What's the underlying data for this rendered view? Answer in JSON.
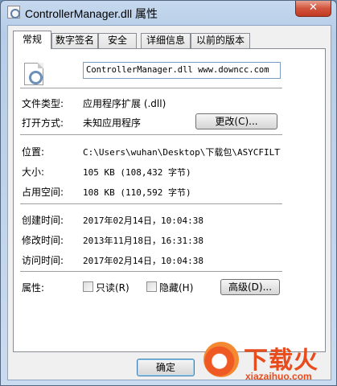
{
  "window": {
    "title": "ControllerManager.dll 属性",
    "close_glyph": "✕"
  },
  "tabs": [
    {
      "label": "常规",
      "active": true
    },
    {
      "label": "数字签名",
      "active": false
    },
    {
      "label": "安全",
      "active": false
    },
    {
      "label": "详细信息",
      "active": false
    },
    {
      "label": "以前的版本",
      "active": false
    }
  ],
  "general": {
    "file_name": "ControllerManager.dll  www.downcc.com",
    "file_type_label": "文件类型:",
    "file_type_value": "应用程序扩展 (.dll)",
    "opens_with_label": "打开方式:",
    "opens_with_value": "未知应用程序",
    "change_button": "更改(C)...",
    "location_label": "位置:",
    "location_value": "C:\\Users\\wuhan\\Desktop\\下载包\\ASYCFILT\\Co",
    "size_label": "大小:",
    "size_value": "105 KB (108,432 字节)",
    "size_on_disk_label": "占用空间:",
    "size_on_disk_value": "108 KB (110,592 字节)",
    "created_label": "创建时间:",
    "created_value": "2017年02月14日，10:04:38",
    "modified_label": "修改时间:",
    "modified_value": "2013年11月18日，16:31:38",
    "accessed_label": "访问时间:",
    "accessed_value": "2017年02月14日，10:04:38",
    "attributes_label": "属性:",
    "readonly_label": "只读(R)",
    "hidden_label": "隐藏(H)",
    "advanced_button": "高级(D)..."
  },
  "footer": {
    "ok_button": "确定"
  },
  "watermark": {
    "brand": "下载火",
    "url": "xiazaihuo.com"
  },
  "icons": [
    "app-icon",
    "close-icon",
    "dll-file-icon",
    "watermark-logo-icon"
  ]
}
